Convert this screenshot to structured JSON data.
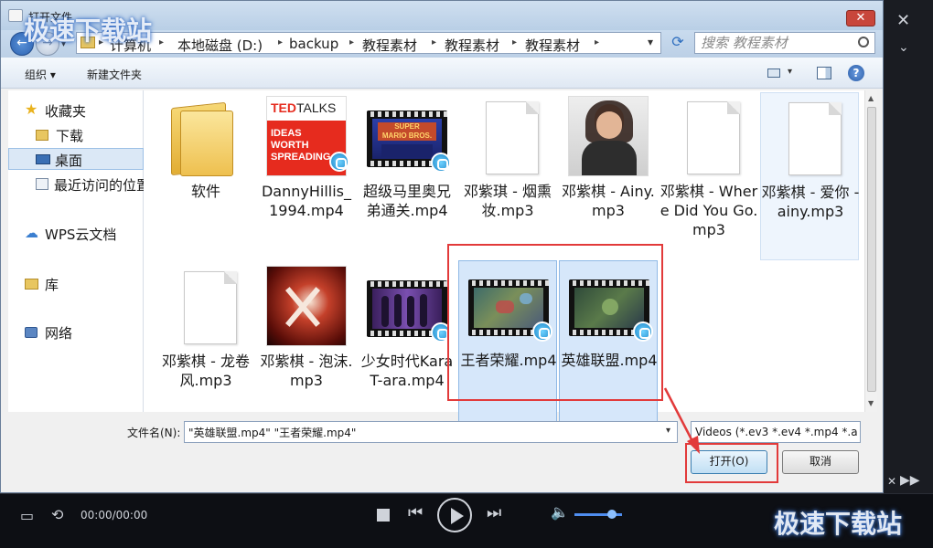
{
  "dialog": {
    "title": "打开文件",
    "close_label": "✕"
  },
  "address": {
    "crumbs": [
      "计算机",
      "本地磁盘 (D:)",
      "backup",
      "教程素材",
      "教程素材",
      "教程素材"
    ],
    "separator": "▸",
    "dropdown": "▾",
    "refresh": "⟳"
  },
  "search": {
    "placeholder": "搜索 教程素材"
  },
  "toolbar": {
    "organize": "组织 ▾",
    "new_folder": "新建文件夹"
  },
  "sidebar": {
    "items": [
      {
        "label": "收藏夹",
        "icon": "star-icon"
      },
      {
        "label": "下载",
        "icon": "download-folder-icon"
      },
      {
        "label": "桌面",
        "icon": "desktop-icon"
      },
      {
        "label": "最近访问的位置",
        "icon": "recent-icon"
      },
      {
        "label": "WPS云文档",
        "icon": "cloud-icon"
      },
      {
        "label": "库",
        "icon": "library-icon"
      },
      {
        "label": "网络",
        "icon": "network-icon"
      }
    ]
  },
  "files": [
    {
      "name": "软件",
      "type": "folder"
    },
    {
      "name": "DannyHillis_1994.mp4",
      "type": "video"
    },
    {
      "name": "超级马里奥兄弟通关.mp4",
      "type": "video"
    },
    {
      "name": "邓紫琪 - 烟熏妆.mp3",
      "type": "audio"
    },
    {
      "name": "邓紫棋 - Ainy.mp3",
      "type": "audio-photo"
    },
    {
      "name": "邓紫棋 - Where Did You Go.mp3",
      "type": "audio"
    },
    {
      "name": "邓紫棋 - 爱你 - ainy.mp3",
      "type": "audio"
    },
    {
      "name": "邓紫棋 - 龙卷风.mp3",
      "type": "audio"
    },
    {
      "name": "邓紫棋 - 泡沫.mp3",
      "type": "audio-photo"
    },
    {
      "name": "少女时代KaraT-ara.mp4",
      "type": "video"
    },
    {
      "name": "王者荣耀.mp4",
      "type": "video"
    },
    {
      "name": "英雄联盟.mp4",
      "type": "video"
    }
  ],
  "footer": {
    "filename_label": "文件名(N):",
    "filename_value": "\"英雄联盟.mp4\" \"王者荣耀.mp4\"",
    "filetype_value": "Videos (*.ev3 *.ev4 *.mp4 *.a",
    "open_label": "打开(O)",
    "cancel_label": "取消"
  },
  "player": {
    "time": "00:00/00:00"
  },
  "watermark": "极速下载站",
  "colors": {
    "accent": "#3f74c7",
    "highlight": "#e23a3a",
    "selection": "#d6e7fa"
  }
}
